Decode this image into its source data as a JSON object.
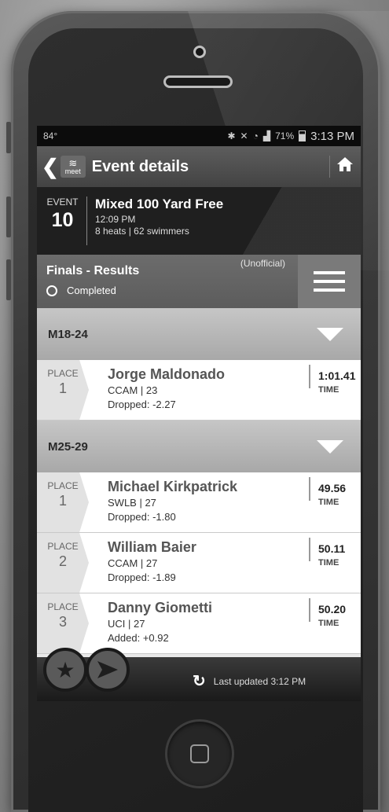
{
  "statusbar": {
    "temp": "84°",
    "icons": [
      "bluetooth-icon",
      "mute-icon",
      "wifi-icon",
      "signal-icon"
    ],
    "battery_percent": "71%",
    "battery_level": 0.71,
    "clock": "3:13 PM"
  },
  "appbar": {
    "logo_text": "meet",
    "title": "Event details"
  },
  "event": {
    "label": "EVENT",
    "number": "10",
    "name": "Mixed 100 Yard Free",
    "time": "12:09 PM",
    "meta": "8 heats | 62 swimmers"
  },
  "results": {
    "title": "Finals - Results",
    "status": "Completed",
    "note": "(Unofficial)"
  },
  "groups": [
    {
      "name": "M18-24",
      "rows": [
        {
          "place_label": "PLACE",
          "place": "1",
          "name": "Jorge Maldonado",
          "team": "CCAM | 23",
          "delta": "Dropped: -2.27",
          "time": "1:01.41",
          "time_label": "TIME"
        }
      ]
    },
    {
      "name": "M25-29",
      "rows": [
        {
          "place_label": "PLACE",
          "place": "1",
          "name": "Michael Kirkpatrick",
          "team": "SWLB | 27",
          "delta": "Dropped: -1.80",
          "time": "49.56",
          "time_label": "TIME"
        },
        {
          "place_label": "PLACE",
          "place": "2",
          "name": "William Baier",
          "team": "CCAM | 27",
          "delta": "Dropped: -1.89",
          "time": "50.11",
          "time_label": "TIME"
        },
        {
          "place_label": "PLACE",
          "place": "3",
          "name": "Danny Giometti",
          "team": "UCI | 27",
          "delta": "Added: +0.92",
          "time": "50.20",
          "time_label": "TIME"
        }
      ]
    }
  ],
  "footer": {
    "last_updated": "Last updated 3:12 PM"
  }
}
